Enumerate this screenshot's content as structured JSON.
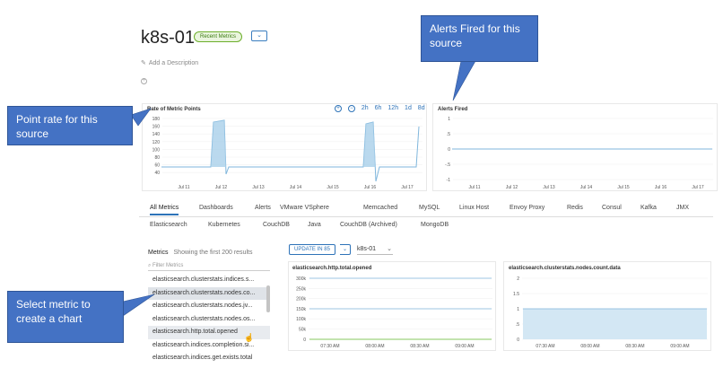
{
  "header": {
    "title": "k8s-01",
    "badge": "Recent Metrics",
    "dropdown_caret": "⌄",
    "add_description": "Add a Description"
  },
  "rate_panel": {
    "title": "Rate of Metric Points",
    "time_ranges": [
      "2h",
      "6h",
      "12h",
      "1d",
      "8d"
    ],
    "y_ticks": [
      "180",
      "160",
      "140",
      "120",
      "100",
      "80",
      "60",
      "40"
    ],
    "x_ticks": [
      "Jul 11",
      "Jul 12",
      "Jul 13",
      "Jul 14",
      "Jul 15",
      "Jul 16",
      "Jul 17"
    ]
  },
  "alerts_panel": {
    "title": "Alerts Fired",
    "y_ticks": [
      "1",
      ".5",
      "0",
      "-.5",
      "-1"
    ],
    "x_ticks": [
      "Jul 11",
      "Jul 12",
      "Jul 13",
      "Jul 14",
      "Jul 15",
      "Jul 16",
      "Jul 17"
    ]
  },
  "tabs": {
    "row1": [
      "All Metrics",
      "Dashboards",
      "Alerts",
      "VMware VSphere",
      "Memcached",
      "MySQL",
      "Linux Host",
      "Envoy Proxy",
      "Redis",
      "Consul",
      "Kafka",
      "JMX"
    ],
    "row2": [
      "Elasticsearch",
      "Kubernetes",
      "CouchDB",
      "Java",
      "CouchDB (Archived)",
      "MongoDB"
    ]
  },
  "metrics": {
    "label": "Metrics",
    "count_text": "Showing the first 200 results",
    "filter_placeholder": "Filter Metrics",
    "items": [
      "elasticsearch.clusterstats.indices.s...",
      "elasticsearch.clusterstats.nodes.co...",
      "elasticsearch.clusterstats.nodes.jv...",
      "elasticsearch.clusterstats.nodes.os...",
      "elasticsearch.http.total.opened",
      "elasticsearch.indices.completion.si...",
      "elasticsearch.indices.get.exists.total"
    ]
  },
  "controls": {
    "update_label": "UPDATE IN 85",
    "update_caret": "⌄",
    "source_value": "k8s-01",
    "source_caret": "⌄"
  },
  "chart_left": {
    "title": "elasticsearch.http.total.opened",
    "y_ticks": [
      "300k",
      "250k",
      "200k",
      "150k",
      "100k",
      "50k",
      "0"
    ],
    "x_ticks": [
      "07:30 AM",
      "08:00 AM",
      "08:30 AM",
      "09:00 AM"
    ]
  },
  "chart_right": {
    "title": "elasticsearch.clusterstats.nodes.count.data",
    "y_ticks": [
      "2",
      "1.5",
      "1",
      ".5",
      "0"
    ],
    "x_ticks": [
      "07:30 AM",
      "08:00 AM",
      "08:30 AM",
      "09:00 AM"
    ]
  },
  "callouts": {
    "point_rate": "Point rate for this source",
    "alerts": "Alerts Fired for this source",
    "select_metric": "Select metric to create a chart"
  },
  "colors": {
    "accent": "#2e73b8",
    "callout": "#4472c4",
    "series": "#7fb6dc",
    "badge_green": "#6cae2b"
  }
}
